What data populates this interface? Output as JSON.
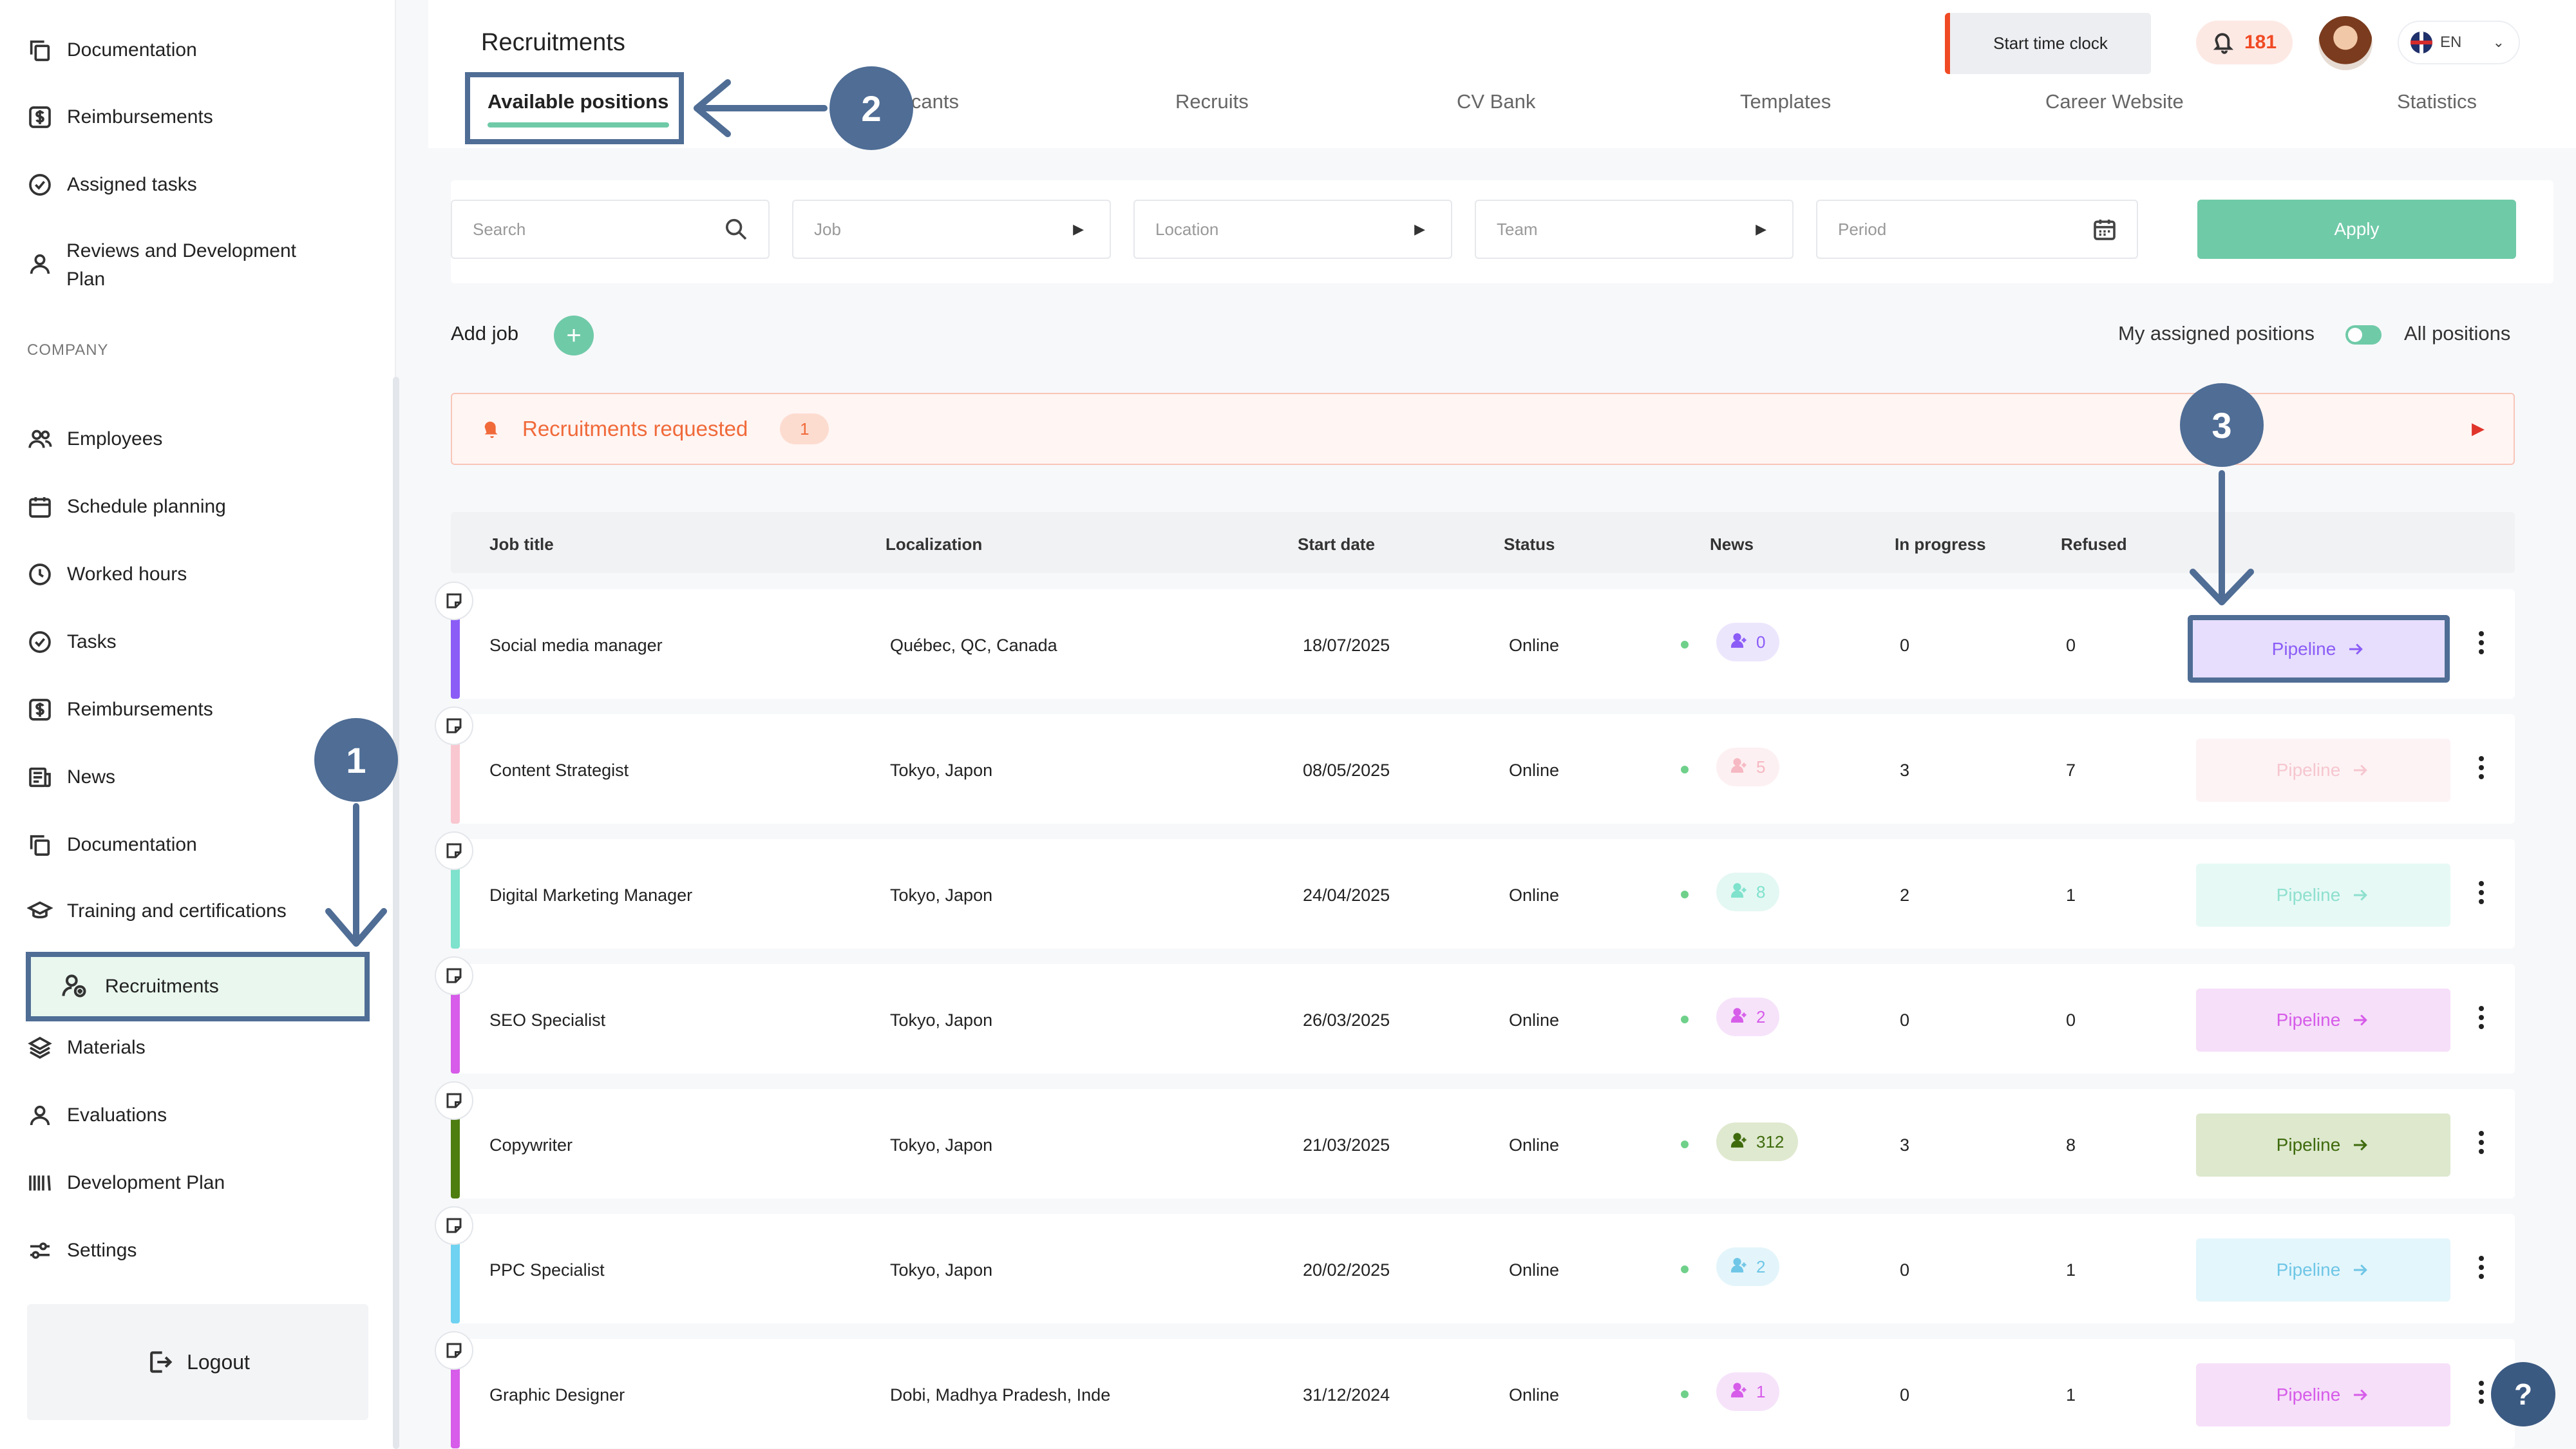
{
  "sidebar": {
    "top_items": [
      {
        "label": "Documentation",
        "icon": "copy-icon"
      },
      {
        "label": "Reimbursements",
        "icon": "dollar-icon"
      },
      {
        "label": "Assigned tasks",
        "icon": "check-circle-icon"
      },
      {
        "label": "Reviews and Development Plan",
        "icon": "user-icon"
      }
    ],
    "section_label": "COMPANY",
    "company_items": [
      {
        "label": "Employees",
        "icon": "users-icon"
      },
      {
        "label": "Schedule planning",
        "icon": "calendar-icon"
      },
      {
        "label": "Worked hours",
        "icon": "clock-icon"
      },
      {
        "label": "Tasks",
        "icon": "check-circle-icon"
      },
      {
        "label": "Reimbursements",
        "icon": "dollar-icon"
      },
      {
        "label": "News",
        "icon": "newspaper-icon"
      },
      {
        "label": "Documentation",
        "icon": "copy-icon"
      },
      {
        "label": "Training and certifications",
        "icon": "graduation-cap-icon"
      },
      {
        "label": "Recruitments",
        "icon": "user-add-icon",
        "active": true
      },
      {
        "label": "Materials",
        "icon": "layers-icon"
      },
      {
        "label": "Evaluations",
        "icon": "user-icon"
      },
      {
        "label": "Development Plan",
        "icon": "bars-icon"
      },
      {
        "label": "Settings",
        "icon": "sliders-icon"
      }
    ],
    "logout_label": "Logout"
  },
  "header": {
    "title": "Recruitments",
    "tabs": [
      {
        "label": "Available positions",
        "active": true
      },
      {
        "label": "icants"
      },
      {
        "label": "Recruits"
      },
      {
        "label": "CV Bank"
      },
      {
        "label": "Templates"
      },
      {
        "label": "Career Website"
      },
      {
        "label": "Statistics"
      }
    ],
    "clock_button": "Start time clock",
    "notification_count": "181",
    "language": "EN"
  },
  "filters": {
    "search_placeholder": "Search",
    "job": "Job",
    "location": "Location",
    "team": "Team",
    "period": "Period",
    "apply": "Apply"
  },
  "toolbar": {
    "add_job": "Add job",
    "my_assigned": "My assigned positions",
    "all_positions": "All positions"
  },
  "requested": {
    "label": "Recruitments requested",
    "count": "1"
  },
  "table": {
    "columns": [
      "Job title",
      "Localization",
      "Start date",
      "Status",
      "News",
      "In progress",
      "Refused"
    ],
    "pipeline_label": "Pipeline",
    "rows": [
      {
        "title": "Social media manager",
        "location": "Québec, QC, Canada",
        "start": "18/07/2025",
        "status": "Online",
        "news": "0",
        "in_progress": "0",
        "refused": "0",
        "color": "#8b5cf6",
        "pill_bg": "#ece6fd",
        "pill_fg": "#8b5cf6",
        "pipe_bg": "#e6defc",
        "pipe_fg": "#8b5cf6"
      },
      {
        "title": "Content Strategist",
        "location": "Tokyo, Japon",
        "start": "08/05/2025",
        "status": "Online",
        "news": "5",
        "in_progress": "3",
        "refused": "7",
        "color": "#f9c7cf",
        "pill_bg": "#fdf0f2",
        "pill_fg": "#f6b8c2",
        "pipe_bg": "#fdf3f5",
        "pipe_fg": "#f6c6cf"
      },
      {
        "title": "Digital Marketing Manager",
        "location": "Tokyo, Japon",
        "start": "24/04/2025",
        "status": "Online",
        "news": "8",
        "in_progress": "2",
        "refused": "1",
        "color": "#7ee2cc",
        "pill_bg": "#e4f8f3",
        "pill_fg": "#7ee2cc",
        "pipe_bg": "#e6f9f5",
        "pipe_fg": "#8fe0cf"
      },
      {
        "title": "SEO Specialist",
        "location": "Tokyo, Japon",
        "start": "26/03/2025",
        "status": "Online",
        "news": "2",
        "in_progress": "0",
        "refused": "0",
        "color": "#d65ce9",
        "pill_bg": "#f6e3fa",
        "pill_fg": "#d65ce9",
        "pipe_bg": "#f6dff9",
        "pipe_fg": "#d65ce9"
      },
      {
        "title": "Copywriter",
        "location": "Tokyo, Japon",
        "start": "21/03/2025",
        "status": "Online",
        "news": "312",
        "in_progress": "3",
        "refused": "8",
        "color": "#4e7d10",
        "pill_bg": "#dfe9cf",
        "pill_fg": "#3f6b0d",
        "pipe_bg": "#dde8cd",
        "pipe_fg": "#3f6b0d"
      },
      {
        "title": "PPC Specialist",
        "location": "Tokyo, Japon",
        "start": "20/02/2025",
        "status": "Online",
        "news": "2",
        "in_progress": "0",
        "refused": "1",
        "color": "#6fd2f0",
        "pill_bg": "#e3f5fb",
        "pill_fg": "#6fc6e6",
        "pipe_bg": "#e3f6fc",
        "pipe_fg": "#6fc6e6"
      },
      {
        "title": "Graphic Designer",
        "location": "Dobi, Madhya Pradesh, Inde",
        "start": "31/12/2024",
        "status": "Online",
        "news": "1",
        "in_progress": "0",
        "refused": "1",
        "color": "#d65ce9",
        "pill_bg": "#f6e3fa",
        "pill_fg": "#d65ce9",
        "pipe_bg": "#f6dff9",
        "pipe_fg": "#d65ce9"
      }
    ]
  },
  "callouts": [
    "1",
    "2",
    "3"
  ],
  "help_label": "?"
}
